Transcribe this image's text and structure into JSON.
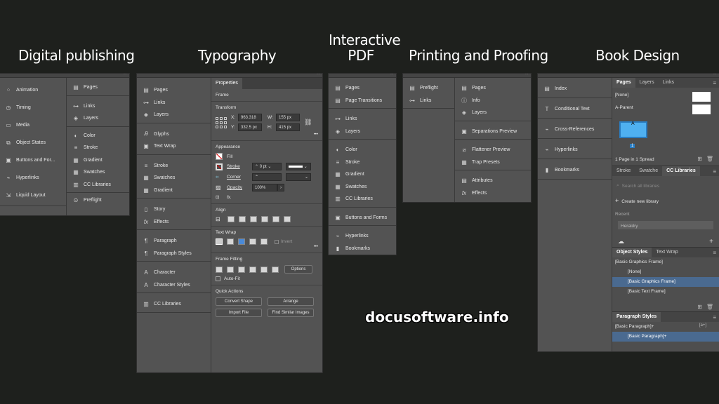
{
  "titles": {
    "digital": "Digital publishing",
    "typography": "Typography",
    "interactive": "Interactive PDF",
    "printing": "Printing and Proofing",
    "book": "Book Design"
  },
  "digital": {
    "left": [
      "Animation",
      "Timing",
      "Media",
      "Object States",
      "Buttons and For...",
      "Hyperlinks",
      "Liquid Layout"
    ],
    "right_g1": [
      "Pages"
    ],
    "right_g2": [
      "Links",
      "Layers"
    ],
    "right_g3": [
      "Color",
      "Stroke",
      "Gradient",
      "Swatches",
      "CC Libraries"
    ],
    "right_g4": [
      "Preflight"
    ]
  },
  "typography": {
    "g1": [
      "Pages",
      "Links",
      "Layers"
    ],
    "g2": [
      "Glyphs",
      "Text Wrap"
    ],
    "g3": [
      "Stroke",
      "Swatches",
      "Gradient"
    ],
    "g4": [
      "Story",
      "Effects"
    ],
    "g5": [
      "Paragraph",
      "Paragraph Styles"
    ],
    "g6": [
      "Character",
      "Character Styles"
    ],
    "g7": [
      "CC Libraries"
    ],
    "props": {
      "tab": "Properties",
      "frame": "Frame",
      "transform": "Transform",
      "x_label": "X:",
      "x_val": "963.318 p",
      "w_label": "W:",
      "w_val": "155 px",
      "y_label": "Y:",
      "y_val": "332.5 px",
      "h_label": "H:",
      "h_val": "415 px",
      "appearance": "Appearance",
      "fill": "Fill",
      "stroke": "Stroke",
      "stroke_val": "0 pt",
      "corner": "Corner",
      "opacity": "Opacity",
      "opacity_val": "100%",
      "fx": "fx.",
      "align": "Align",
      "textwrap": "Text Wrap",
      "invert": "Invert",
      "framefitting": "Frame Fitting",
      "options": "Options",
      "autofit": "Auto-Fit",
      "quickactions": "Quick Actions",
      "convert_shape": "Convert Shape",
      "arrange": "Arrange",
      "import_file": "Import File",
      "find_similar": "Find Similar Images",
      "more": "•••"
    }
  },
  "interactive": {
    "g1": [
      "Pages",
      "Page Transitions"
    ],
    "g2": [
      "Links",
      "Layers"
    ],
    "g3": [
      "Color",
      "Stroke",
      "Gradient",
      "Swatches",
      "CC Libraries"
    ],
    "g4": [
      "Buttons and Forms"
    ],
    "g5": [
      "Hyperlinks",
      "Bookmarks"
    ]
  },
  "printing": {
    "left": [
      "Preflight",
      "Links"
    ],
    "g1": [
      "Pages",
      "Info",
      "Layers"
    ],
    "g2": [
      "Separations Preview"
    ],
    "g3": [
      "Flattener Preview",
      "Trap Presets"
    ],
    "g4": [
      "Attributes",
      "Effects"
    ]
  },
  "book": {
    "left": [
      "Index",
      "Conditional Text",
      "Cross-References",
      "Hyperlinks",
      "Bookmarks"
    ],
    "pages_tabs": [
      "Pages",
      "Layers",
      "Links"
    ],
    "none": "[None]",
    "aparent": "A-Parent",
    "page_num": "1",
    "page_letter": "A",
    "pages_status": "1 Page in 1 Spread",
    "cc_tabs": [
      "Stroke",
      "Swatche",
      "CC Libraries"
    ],
    "search_placeholder": "Search all libraries",
    "create_library": "Create new library",
    "recent": "Recent",
    "heraldry": "Heraldry",
    "os_tabs": [
      "Object Styles",
      "Text Wrap"
    ],
    "os_rows": [
      "[Basic Graphics Frame]",
      "[None]",
      "[Basic Graphics Frame]",
      "[Basic Text Frame]"
    ],
    "ps_tab": "Paragraph Styles",
    "ps_rows": [
      "[Basic Paragraph]+",
      "[Basic Paragraph]+"
    ],
    "ps_badge": "[a+]"
  },
  "watermark": "docusoftware.info"
}
